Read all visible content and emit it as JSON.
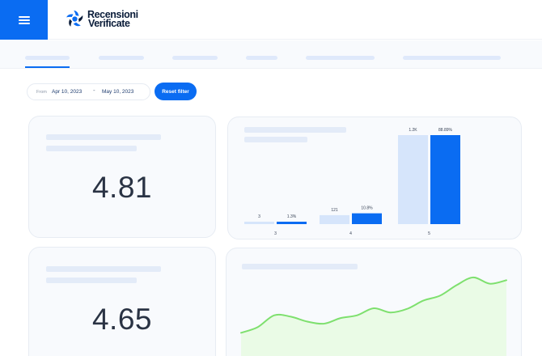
{
  "brand": {
    "line1": "Recensioni",
    "line2": "Verificate",
    "accent_color": "#0a6cf2",
    "logo_icon": "star-logo-icon",
    "menu_icon": "hamburger-menu-icon"
  },
  "filter": {
    "from_label": "From",
    "start_date": "Apr 10, 2023",
    "separator": "-",
    "end_date": "May 10, 2023",
    "reset_label": "Reset filter"
  },
  "cards": {
    "rating_1": {
      "value": "4.81"
    },
    "rating_2": {
      "value": "4.65"
    }
  },
  "chart_data": [
    {
      "type": "bar",
      "categories": [
        "3",
        "4",
        "5"
      ],
      "series": [
        {
          "values": [
            3,
            121,
            1200
          ],
          "labels": [
            "3",
            "121",
            "1.2K"
          ],
          "color": "#d6e5fb"
        },
        {
          "values": [
            1.3,
            10.8,
            88.89
          ],
          "labels": [
            "1.3%",
            "10.8%",
            "88.89%"
          ],
          "color": "#0a6cf2"
        }
      ],
      "grid": false
    },
    {
      "type": "area",
      "x": [
        0,
        1,
        2,
        3,
        4,
        5,
        6,
        7,
        8,
        9,
        10,
        11,
        12,
        13,
        14,
        15,
        16
      ],
      "values": [
        1.0,
        1.8,
        3.5,
        3.3,
        2.6,
        2.3,
        3.1,
        3.5,
        4.5,
        3.9,
        4.4,
        5.6,
        6.3,
        7.8,
        8.9,
        8.0,
        8.5
      ],
      "line_color": "#7ee06e",
      "fill_color": "#eafbe6",
      "grid": false
    }
  ]
}
